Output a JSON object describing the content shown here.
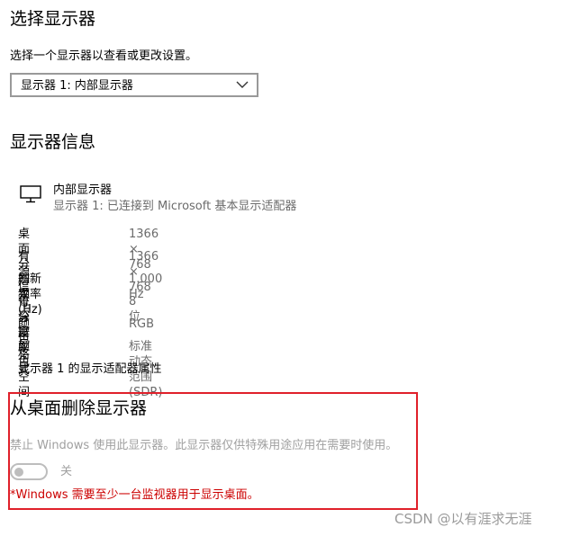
{
  "select_display": {
    "title": "选择显示器",
    "description": "选择一个显示器以查看或更改设置。",
    "dropdown_value": "显示器 1: 内部显示器"
  },
  "display_info": {
    "title": "显示器信息",
    "monitor_name": "内部显示器",
    "monitor_subtitle": "显示器 1: 已连接到 Microsoft 基本显示适配器",
    "rows": [
      {
        "label": "桌面分辨率",
        "value": "1366 × 768"
      },
      {
        "label": "有源信号分辨率",
        "value": "1366 × 768"
      },
      {
        "label": "刷新频率(Hz)",
        "value": "1.000 Hz"
      },
      {
        "label": "位深度",
        "value": "8 位"
      },
      {
        "label": "颜色格式",
        "value": "RGB"
      },
      {
        "label": "颜色空间",
        "value": "标准动态范围(SDR)"
      }
    ],
    "adapter_link": "显示器 1 的显示适配器属性"
  },
  "remove_display": {
    "title": "从桌面删除显示器",
    "description": "禁止 Windows 使用此显示器。此显示器仅供特殊用途应用在需要时使用。",
    "toggle_state": "关",
    "warning": "*Windows 需要至少一台监视器用于显示桌面。"
  },
  "watermark": "CSDN @以有涯求无涯",
  "colors": {
    "highlight_border": "#e0202a",
    "warning_text": "#cc0000",
    "secondary_text": "#6b6b6b",
    "disabled_text": "#a0a0a0"
  }
}
